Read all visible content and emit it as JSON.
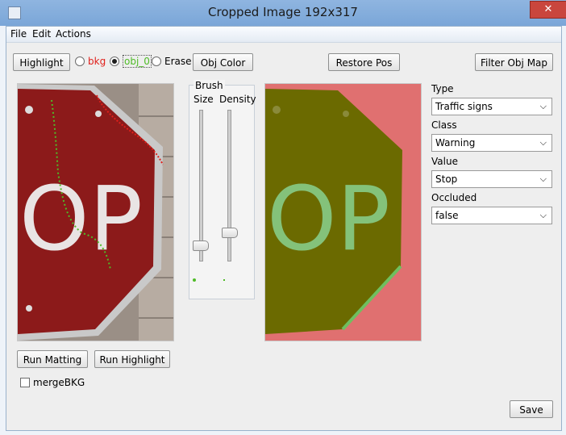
{
  "window": {
    "title": "Cropped Image  192x317",
    "close_glyph": "✕"
  },
  "menu": [
    "File",
    "Edit",
    "Actions"
  ],
  "toolbar": {
    "highlight_label": "Highlight",
    "radio_bkg_label": "bkg",
    "radio_obj_label": "obj_0",
    "radio_erase_label": "Erase",
    "selected_radio": "obj_0",
    "obj_color_label": "Obj Color",
    "restore_pos_label": "Restore Pos",
    "filter_obj_map_label": "Filter Obj Map",
    "bkg_color": "#e0201b",
    "obj_color": "#4fbb27"
  },
  "brush": {
    "title": "Brush",
    "size_label": "Size",
    "density_label": "Density",
    "size_value_fraction": 0.12,
    "density_value_fraction": 0.2
  },
  "image_left": {
    "sign_text": "OP",
    "sign_color": "#8c1a1a"
  },
  "image_right": {
    "sign_text": "OP",
    "overlay_obj": "#6b6a00",
    "overlay_bkg": "#e06464"
  },
  "bottom": {
    "run_matting_label": "Run Matting",
    "run_highlight_label": "Run Highlight",
    "merge_bkg_label": "mergeBKG",
    "merge_bkg_checked": false,
    "save_label": "Save"
  },
  "fields": [
    {
      "label": "Type",
      "value": "Traffic signs"
    },
    {
      "label": "Class",
      "value": "Warning"
    },
    {
      "label": "Value",
      "value": "Stop"
    },
    {
      "label": "Occluded",
      "value": "false"
    }
  ]
}
